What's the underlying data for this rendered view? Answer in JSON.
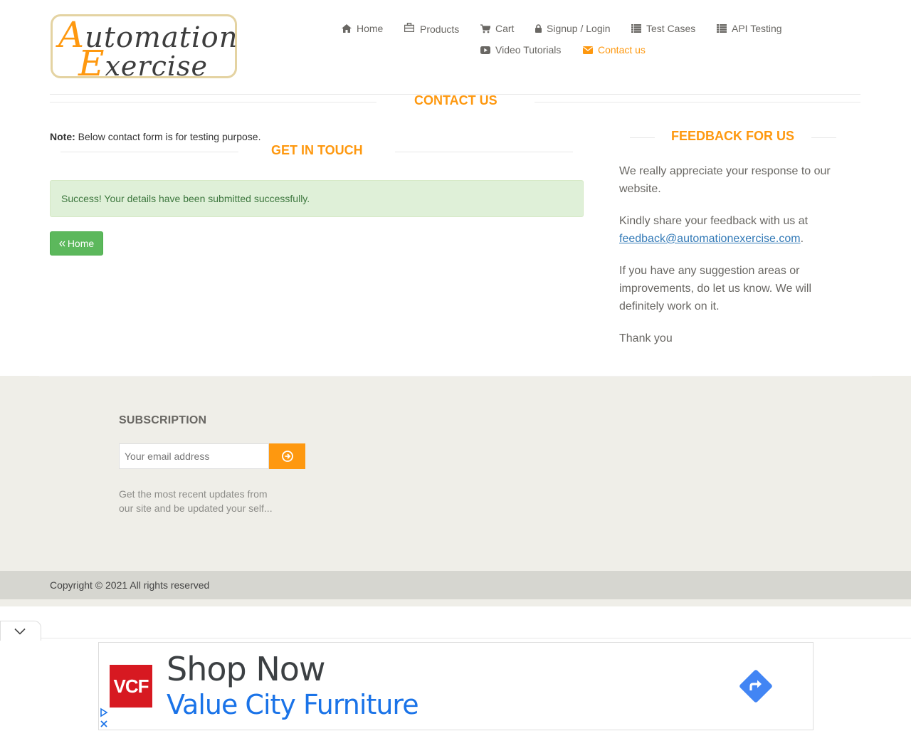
{
  "logo": {
    "line1_cap": "A",
    "line1_rest": "utomation",
    "line2_cap": "E",
    "line2_rest": "xercise"
  },
  "nav": {
    "home": "Home",
    "products": "Products",
    "cart": "Cart",
    "signup_login": "Signup / Login",
    "test_cases": "Test Cases",
    "api_testing": "API Testing",
    "video_tutorials": "Video Tutorials",
    "contact_us": "Contact us"
  },
  "page": {
    "title": "Contact Us",
    "note_label": "Note:",
    "note_text": " Below contact form is for testing purpose.",
    "get_in_touch": "Get In Touch",
    "success_message": "Success! Your details have been submitted successfully.",
    "home_button": "Home"
  },
  "feedback": {
    "title": "Feedback For Us",
    "p1": "We really appreciate your response to our website.",
    "p2_prefix": "Kindly share your feedback with us at ",
    "email": "feedback@automationexercise.com",
    "p2_suffix": ".",
    "p3": "If you have any suggestion areas or improvements, do let us know. We will definitely work on it.",
    "p4": "Thank you"
  },
  "footer": {
    "subscription_title": "SUBSCRIPTION",
    "email_placeholder": "Your email address",
    "subscription_desc": "Get the most recent updates from our site and be updated your self...",
    "copyright": "Copyright © 2021 All rights reserved"
  },
  "ad": {
    "logo_text": "VCF",
    "headline": "Shop Now",
    "advertiser": "Value City Furniture"
  },
  "colors": {
    "accent": "#fe980f",
    "success_bg": "#dff0d8",
    "success_text": "#3c763d",
    "button_green": "#5cb85c",
    "link": "#337ab7"
  }
}
